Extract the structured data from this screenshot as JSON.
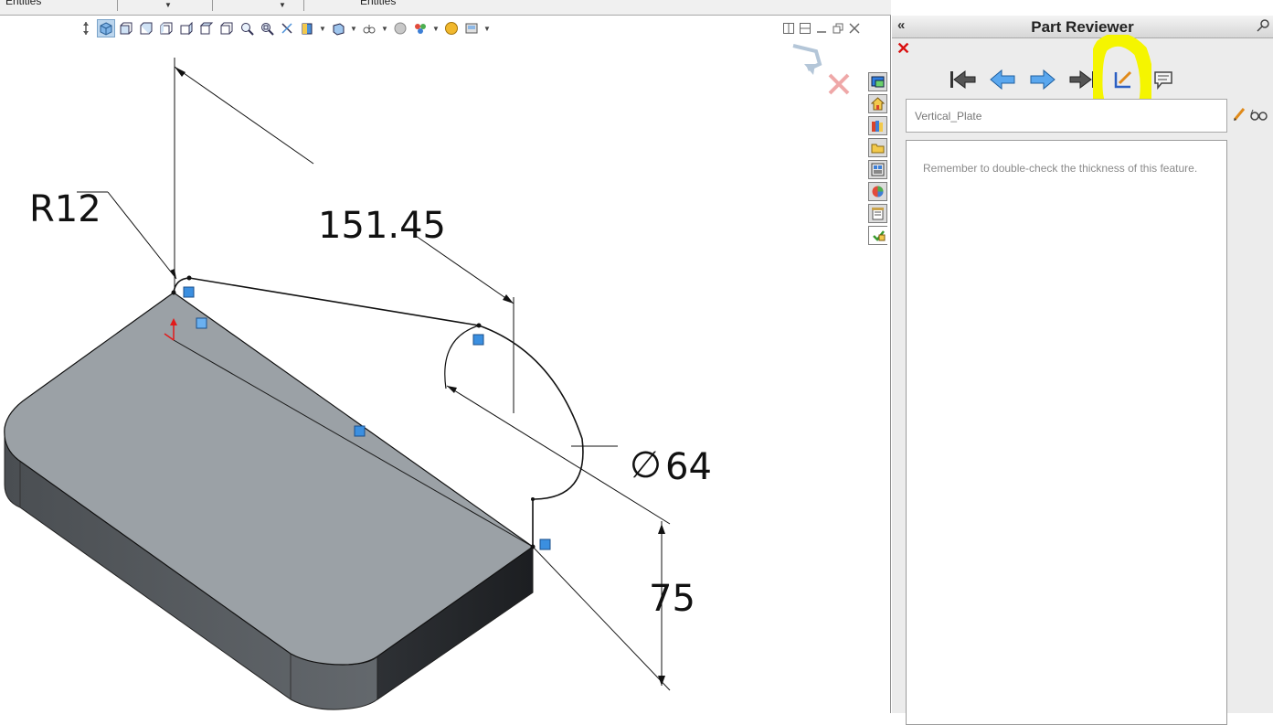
{
  "top_strip": {
    "left_label": "Entities",
    "right_label": "Entities"
  },
  "panel": {
    "title": "Part Reviewer",
    "feature_name": "Vertical_Plate",
    "comment": "Remember to double-check the thickness of this feature."
  },
  "dimensions": {
    "radius": "R12",
    "length": "151.45",
    "diameter": "64",
    "height": "75"
  },
  "colors": {
    "panel_bg": "#ececec",
    "highlight": "#f5f500",
    "close_red": "#d91010",
    "nav_blue": "#3a8fde",
    "model_top": "#9ba1a6",
    "model_side": "#5e6266"
  },
  "icons": {
    "view_toolbar": [
      "view-orientation-icon",
      "isometric-view-icon",
      "front-view-icon",
      "back-view-icon",
      "left-view-icon",
      "right-view-icon",
      "top-view-icon",
      "zoom-to-fit-icon",
      "zoom-to-area-icon",
      "rotate-view-icon",
      "section-view-icon",
      "display-style-icon",
      "hide-show-icon",
      "edit-appearance-icon",
      "apply-scene-icon",
      "view-settings-icon"
    ],
    "side_tabs": [
      "feature-manager-icon",
      "home-icon",
      "design-library-icon",
      "file-explorer-icon",
      "view-palette-icon",
      "appearances-icon",
      "custom-properties-icon",
      "part-reviewer-icon"
    ],
    "nav": [
      "first-icon",
      "previous-icon",
      "next-icon",
      "last-icon",
      "edit-comment-icon",
      "add-comment-icon"
    ]
  }
}
